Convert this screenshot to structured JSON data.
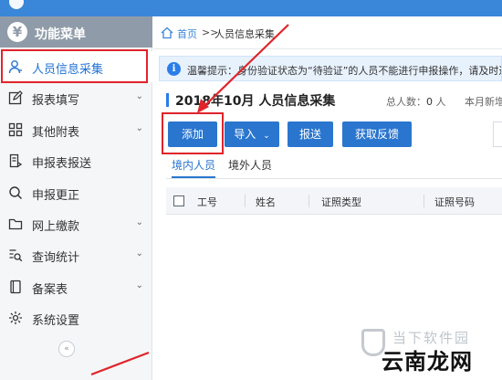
{
  "sidebar": {
    "title": "功能菜单",
    "items": [
      {
        "label": "人员信息采集",
        "chevron": ""
      },
      {
        "label": "报表填写",
        "chevron": "⌄"
      },
      {
        "label": "其他附表",
        "chevron": "⌄"
      },
      {
        "label": "申报表报送",
        "chevron": ""
      },
      {
        "label": "申报更正",
        "chevron": ""
      },
      {
        "label": "网上缴款",
        "chevron": "⌄"
      },
      {
        "label": "查询统计",
        "chevron": "⌄"
      },
      {
        "label": "备案表",
        "chevron": "⌄"
      },
      {
        "label": "系统设置",
        "chevron": ""
      }
    ],
    "collapse_label": "«",
    "icons": [
      "person-icon",
      "edit-icon",
      "grid-icon",
      "report-submit-icon",
      "search-icon",
      "folder-icon",
      "query-stats-icon",
      "record-icon",
      "gear-icon"
    ]
  },
  "breadcrumb": {
    "home": "首页",
    "separator": ">>",
    "current": "人员信息采集"
  },
  "notice": {
    "text": "温馨提示：身份验证状态为“待验证”的人员不能进行申报操作，请及时进行"
  },
  "page": {
    "title": "2018年10月  人员信息采集",
    "total_label": "总人数：",
    "total_value": "0",
    "total_unit": "人",
    "month_new": "本月新增"
  },
  "toolbar": {
    "add_label": "添加",
    "import_label": "导入",
    "submit_label": "报送",
    "feedback_label": "获取反馈"
  },
  "tabs": [
    {
      "label": "境内人员",
      "active": true
    },
    {
      "label": "境外人员",
      "active": false
    }
  ],
  "table": {
    "columns": [
      "工号",
      "姓名",
      "证照类型",
      "证照号码"
    ],
    "rows": []
  },
  "watermark": {
    "line1": "当下软件园",
    "line2": "云南龙网"
  },
  "colors": {
    "accent": "#2a76cf",
    "highlight": "#e0242a",
    "sidebar_header": "#8f9ba8"
  }
}
